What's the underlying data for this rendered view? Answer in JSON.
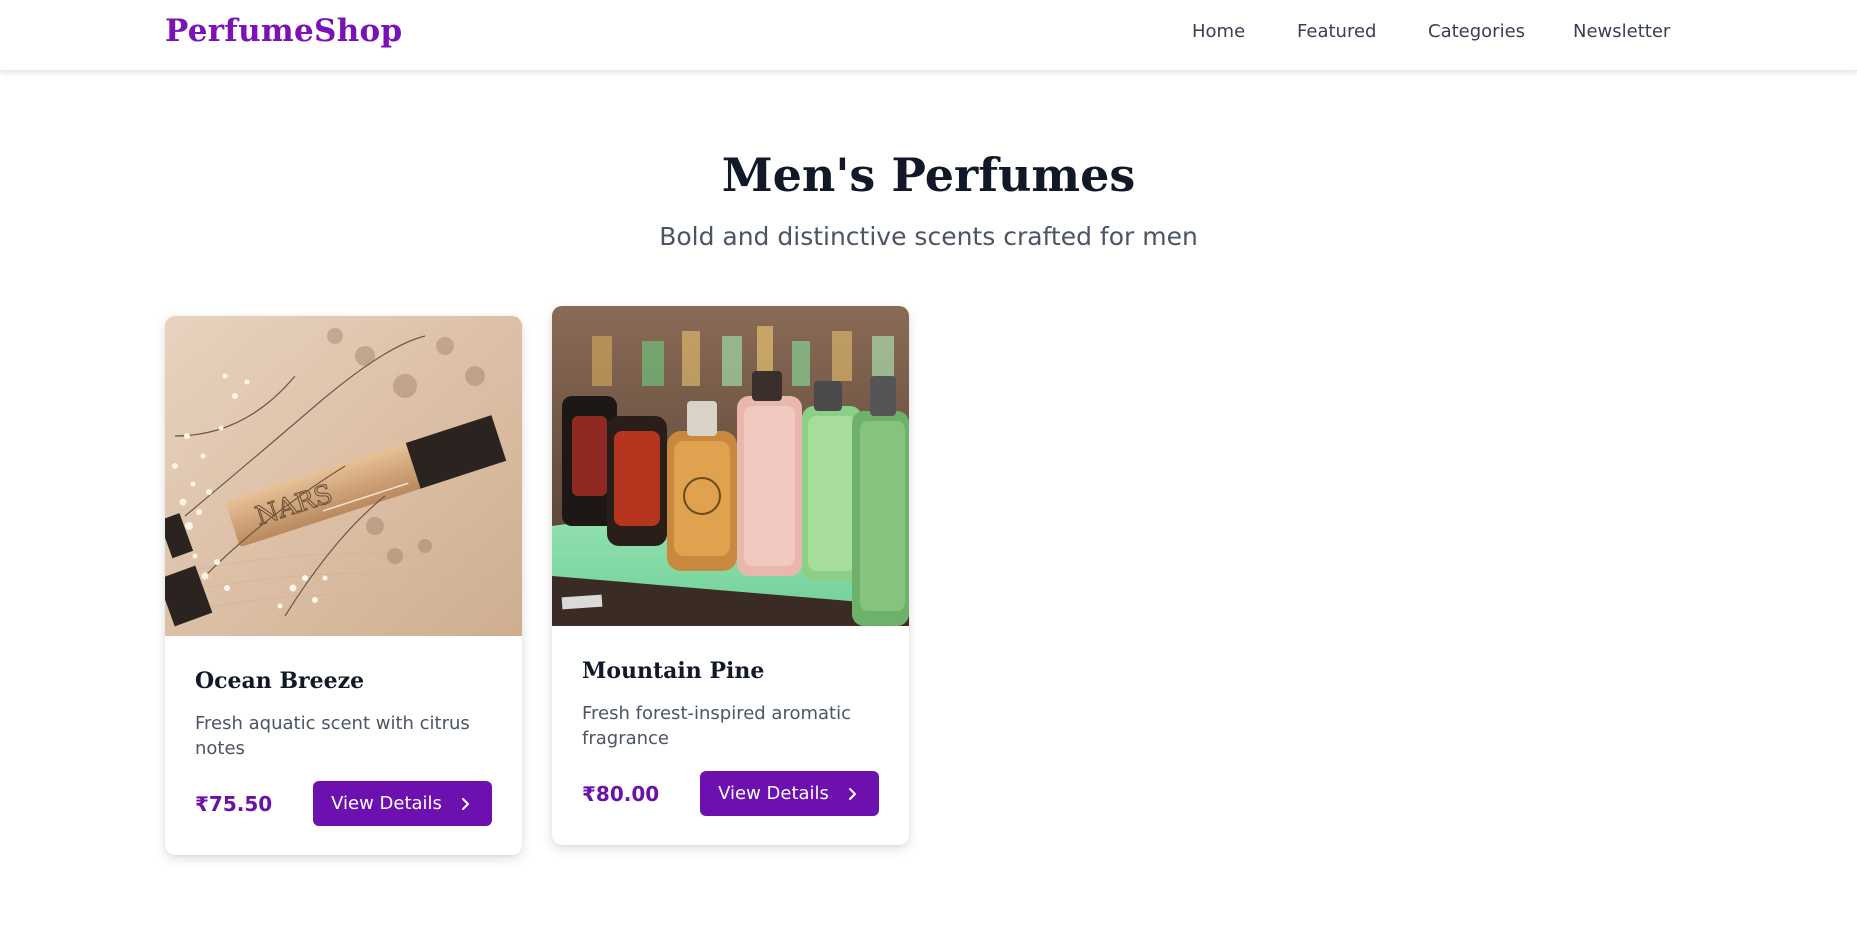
{
  "brand": {
    "name": "PerfumeShop",
    "color": "#7a12b8"
  },
  "nav": {
    "items": [
      {
        "label": "Home"
      },
      {
        "label": "Featured"
      },
      {
        "label": "Categories"
      },
      {
        "label": "Newsletter"
      }
    ]
  },
  "hero": {
    "title": "Men's Perfumes",
    "subtitle": "Bold and distinctive scents crafted for men"
  },
  "products": [
    {
      "name": "Ocean Breeze",
      "description": "Fresh aquatic scent with citrus notes",
      "price": "₹75.50",
      "button_label": "View Details",
      "button_icon": "chevron-right-icon",
      "image_alt": "NARS concealer tube with baby's breath flowers"
    },
    {
      "name": "Mountain Pine",
      "description": "Fresh forest-inspired aromatic fragrance",
      "price": "₹80.00",
      "button_label": "View Details",
      "button_icon": "chevron-right-icon",
      "image_alt": "Rows of Gucci perfume bottles on a lit shelf"
    }
  ],
  "colors": {
    "accent": "#6c10b0",
    "price": "#6b11a8",
    "heading": "#111827",
    "muted": "#4b5563"
  }
}
